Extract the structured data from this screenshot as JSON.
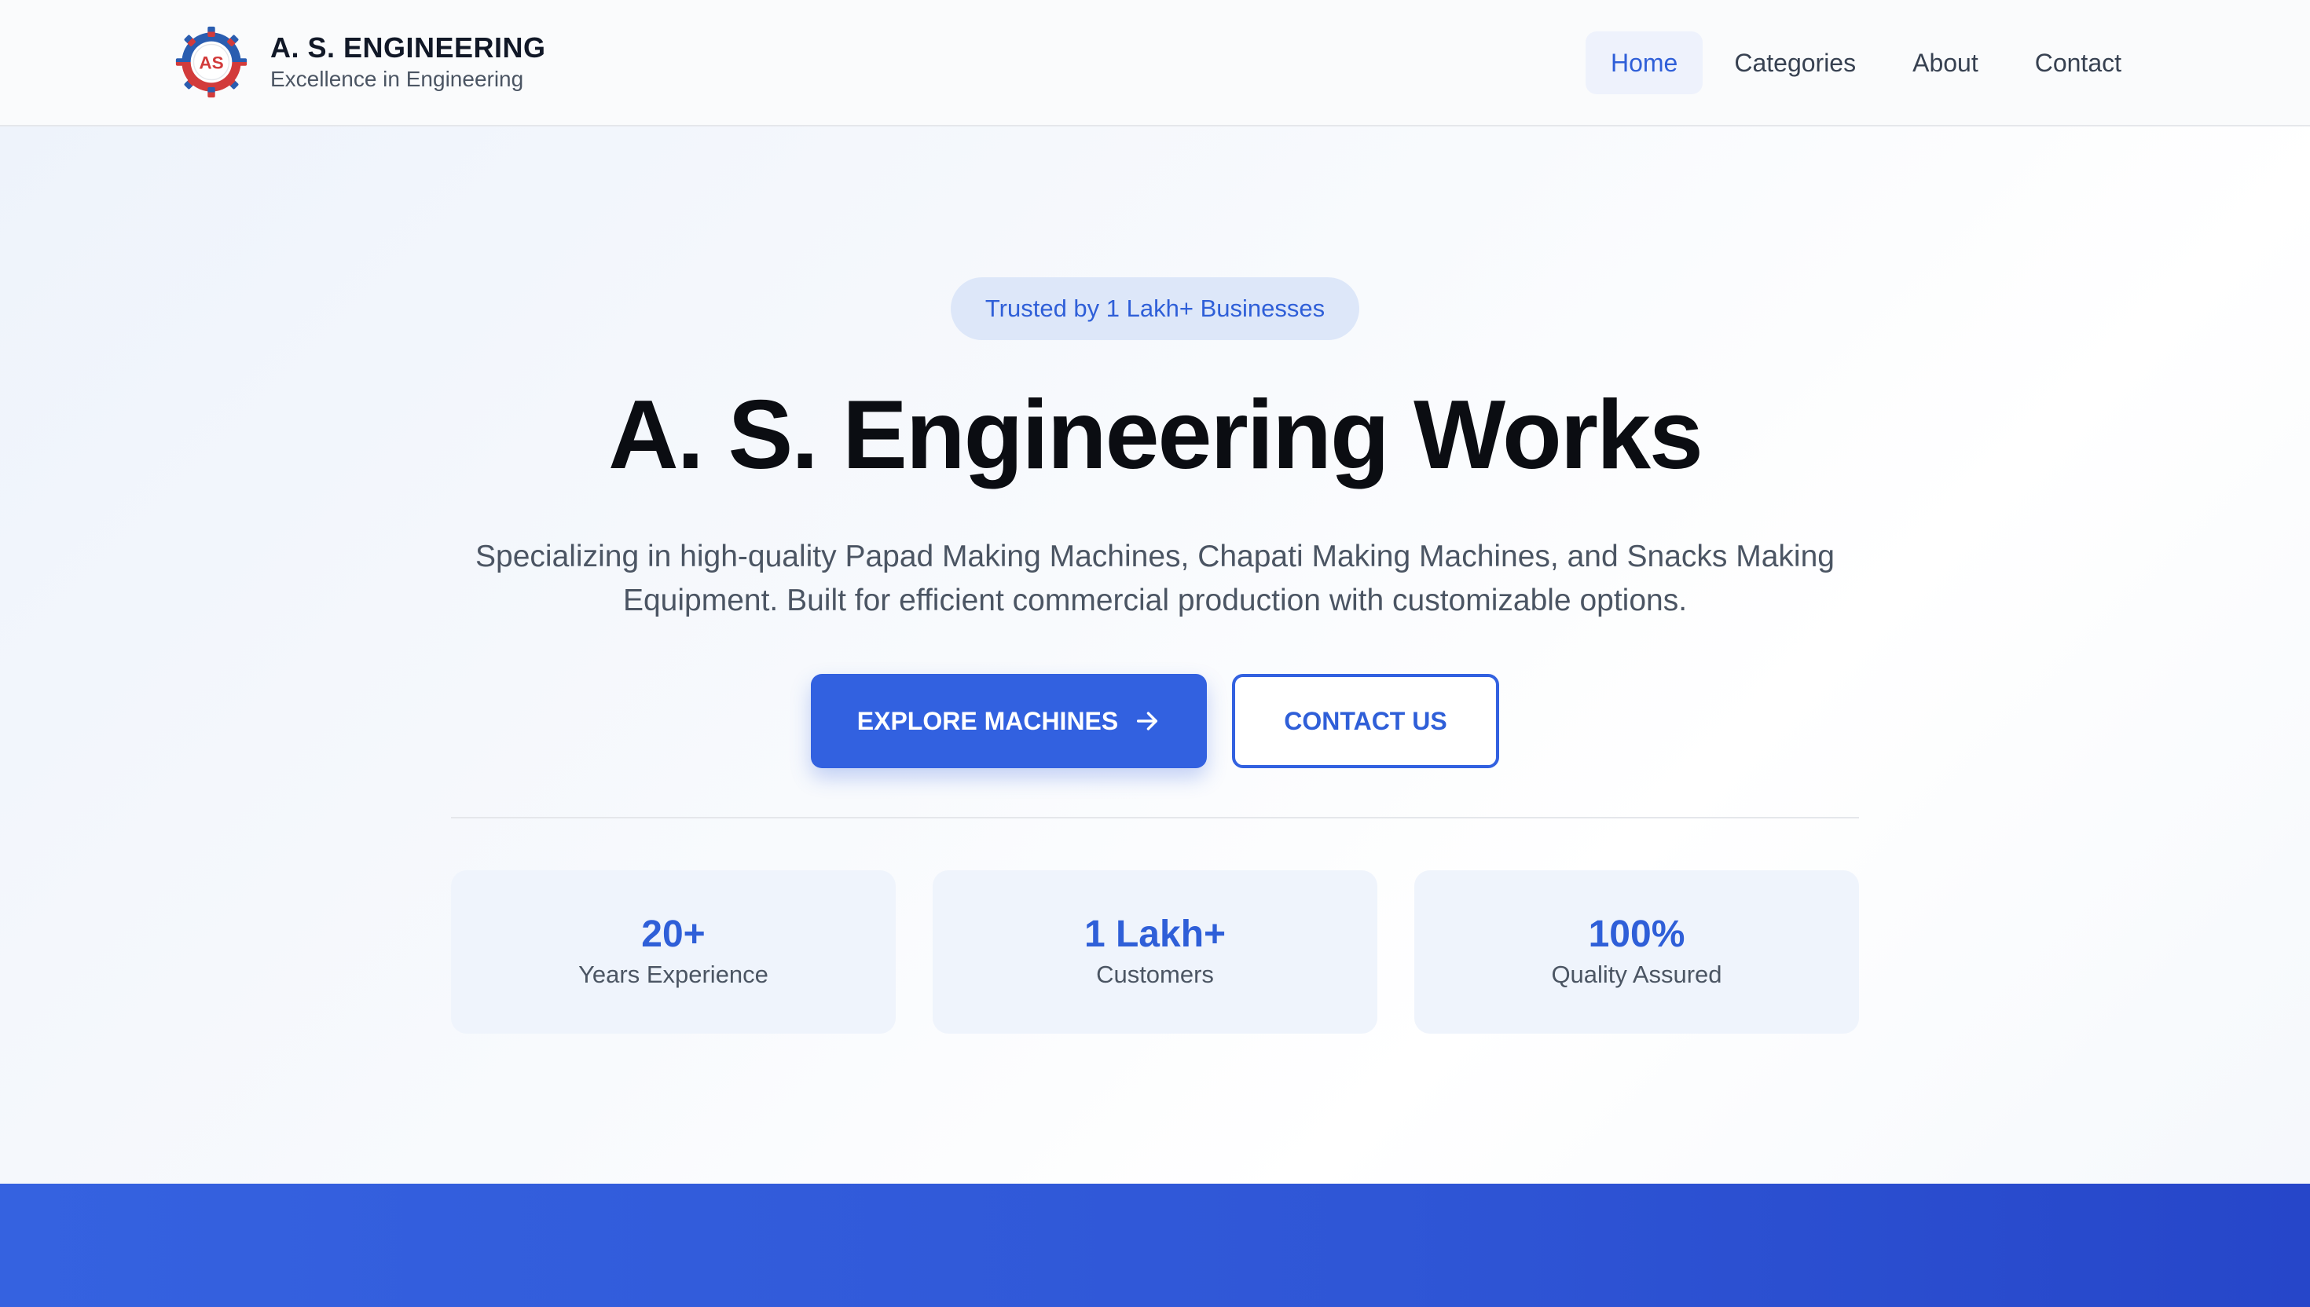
{
  "header": {
    "brand_name": "A. S. ENGINEERING",
    "brand_tagline": "Excellence in Engineering",
    "logo_letters": "AS",
    "nav": [
      {
        "label": "Home",
        "active": true
      },
      {
        "label": "Categories",
        "active": false
      },
      {
        "label": "About",
        "active": false
      },
      {
        "label": "Contact",
        "active": false
      }
    ]
  },
  "hero": {
    "badge": "Trusted by 1 Lakh+ Businesses",
    "title": "A. S. Engineering Works",
    "description_line1": "Specializing in high-quality Papad Making Machines, Chapati Making Machines, and Snacks Making",
    "description_line2": "Equipment. Built for efficient commercial production with customizable options.",
    "primary_button": "EXPLORE MACHINES",
    "secondary_button": "CONTACT US"
  },
  "stats": [
    {
      "value": "20+",
      "label": "Years Experience"
    },
    {
      "value": "1 Lakh+",
      "label": "Customers"
    },
    {
      "value": "100%",
      "label": "Quality Assured"
    }
  ],
  "colors": {
    "accent": "#3261e0",
    "badge_bg": "#dde7f9",
    "stat_bg": "#eff4fc",
    "title": "#0b0d12",
    "body_text": "#4b5563"
  }
}
